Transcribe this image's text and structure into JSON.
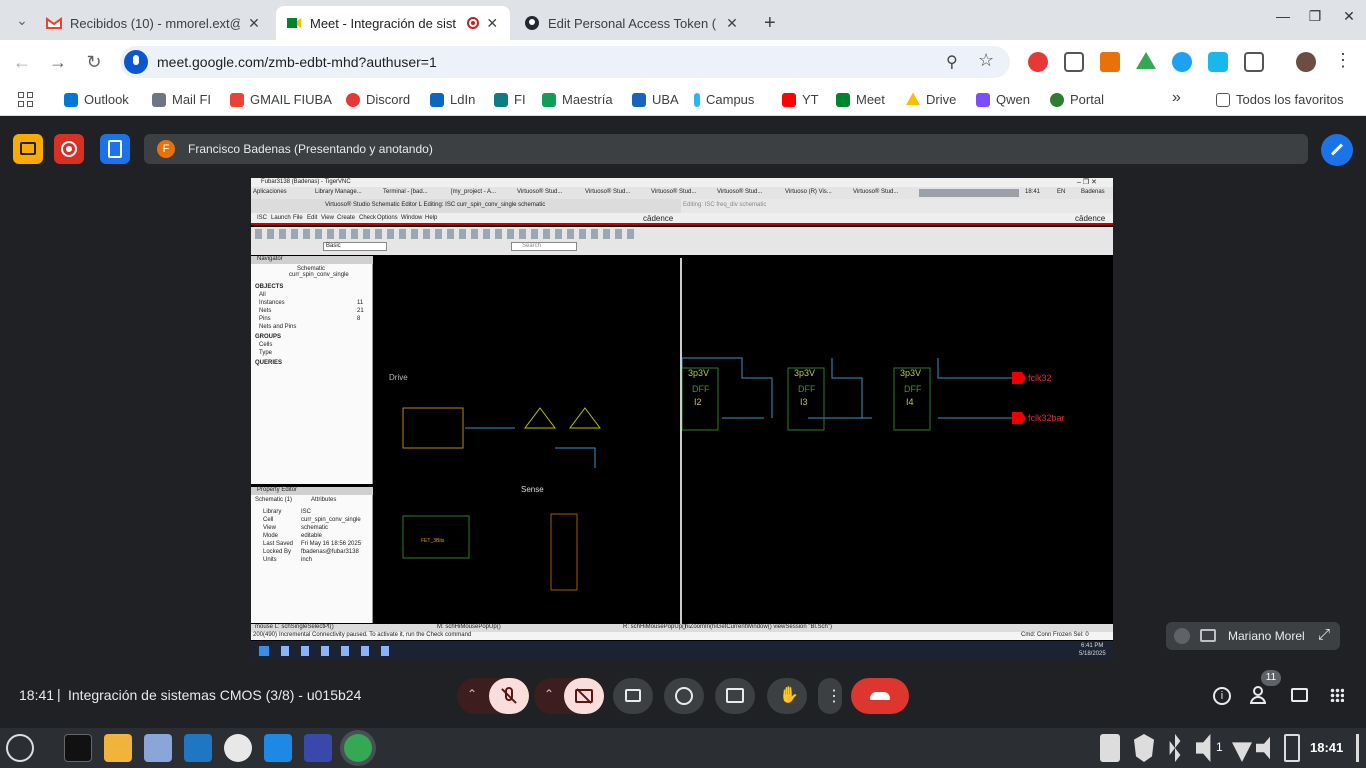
{
  "browser": {
    "tabs": [
      {
        "title": "Recibidos (10) - mmorel.ext@",
        "close": "✕"
      },
      {
        "title": "Meet - Integración de sist",
        "close": "✕"
      },
      {
        "title": "Edit Personal Access Token (",
        "close": "✕"
      }
    ],
    "new_tab": "+",
    "url": "meet.google.com/zmb-edbt-mhd?authuser=1",
    "bookmarks": [
      "Outlook",
      "Mail FI",
      "GMAIL FIUBA",
      "Discord",
      "LdIn",
      "FI",
      "Maestría",
      "UBA",
      "Campus",
      "YT",
      "Meet",
      "Drive",
      "Qwen",
      "Portal"
    ],
    "all_bookmarks": "Todos los favoritos",
    "more": "»"
  },
  "meet": {
    "presenter_initial": "F",
    "presenter_label": "Francisco Badenas (Presentando y anotando)",
    "self_tile_name": "Mariano Morel",
    "time": "18:41",
    "meeting_title": "Integración de sistemas CMOS (3/8) - u015b24",
    "participants_count": "11"
  },
  "shared": {
    "window_title": "Fubar3138 (Badenas) - TigerVNC",
    "vnc_taskbar": [
      "Aplicaciones",
      "Library Manage...",
      "Terminal - [bad...",
      "[my_project - A...",
      "Virtuoso® Stud...",
      "Virtuoso® Stud...",
      "Virtuoso® Stud...",
      "Virtuoso® Stud...",
      "Virtuoso (R) Vis...",
      "Virtuoso® Stud..."
    ],
    "vnc_clock": "18:41",
    "vnc_lang": "EN",
    "vnc_user": "Badenas",
    "editor_title": "Virtuoso® Studio Schematic Editor L Editing: ISC curr_spin_conv_single schematic",
    "editor2_title": "Editing: ISC freq_div schematic",
    "cadence": "cādence",
    "menus": [
      "ISC",
      "Launch",
      "File",
      "Edit",
      "View",
      "Create",
      "Check",
      "Options",
      "Window",
      "Help"
    ],
    "toolbar_combo": "Basic",
    "search_placeholder": "Search",
    "navigator_title": "Navigator",
    "navigator_subtitle": "Schematic",
    "navigator_cell": "curr_spin_conv_single",
    "objects_header": "OBJECTS",
    "objects": [
      [
        "All",
        ""
      ],
      [
        "Instances",
        "11"
      ],
      [
        "Nets",
        "21"
      ],
      [
        "Pins",
        "8"
      ],
      [
        "Nets and Pins",
        ""
      ]
    ],
    "groups_header": "GROUPS",
    "groups": [
      "Cells",
      "Type"
    ],
    "queries_header": "QUERIES",
    "property_editor": "Property Editor",
    "prop_tab1": "Schematic (1)",
    "prop_tab2": "Attributes",
    "properties": [
      [
        "Library",
        "ISC"
      ],
      [
        "Cell",
        "curr_spin_conv_single"
      ],
      [
        "View",
        "schematic"
      ],
      [
        "Mode",
        "editable"
      ],
      [
        "Last Saved",
        "Fri May 16 18:56 2025"
      ],
      [
        "Locked By",
        "fbadenas@fubar3138"
      ],
      [
        "Units",
        "inch"
      ]
    ],
    "sch_label_drive": "Drive",
    "sch_label_sense": "Sense",
    "sch_instance": "FET_3Bits",
    "freq_div": [
      {
        "top": "3p3V",
        "name": "DFF",
        "inst": "I2"
      },
      {
        "top": "3p3V",
        "name": "DFF",
        "inst": "I3"
      },
      {
        "top": "3p3V",
        "name": "DFF",
        "inst": "I4"
      }
    ],
    "out1": "fclk32",
    "out2": "fclk32bar",
    "status_left": "mouse L: schSingleSelectPt()",
    "status_mid": "M: schHiMousePopUp()",
    "status_right": "R: schHiMousePopUp()",
    "status_mid2": "hiZoomIn(hiGetCurrentWindow() viewSession \"Bl.Sch\")",
    "status_cmd": "Incremental Connectivity paused. To activate it, run the Check command",
    "status_coord": "200(490)",
    "status_cmd_right": "Cmd: Conn Frozen Sel: 0",
    "win_clock": "6:41 PM",
    "win_date": "5/18/2025",
    "win_lang": "ENG\nINTL"
  },
  "os": {
    "clock": "18:41",
    "volume_label": "1"
  }
}
